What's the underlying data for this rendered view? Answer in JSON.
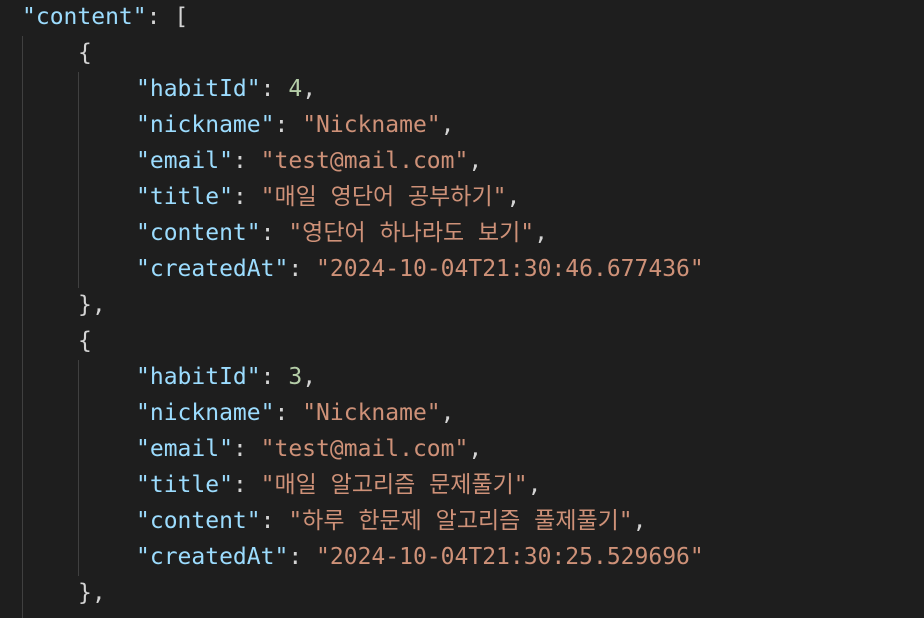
{
  "root_key": "\"content\"",
  "open_bracket": "[",
  "open_brace": "{",
  "close_brace": "},",
  "colon": ": ",
  "comma": ",",
  "items": [
    {
      "habitId_key": "\"habitId\"",
      "habitId_val": "4",
      "nickname_key": "\"nickname\"",
      "nickname_val": "\"Nickname\"",
      "email_key": "\"email\"",
      "email_val": "\"test@mail.com\"",
      "title_key": "\"title\"",
      "title_val": "\"매일 영단어 공부하기\"",
      "content_key": "\"content\"",
      "content_val": "\"영단어 하나라도 보기\"",
      "createdAt_key": "\"createdAt\"",
      "createdAt_val": "\"2024-10-04T21:30:46.677436\""
    },
    {
      "habitId_key": "\"habitId\"",
      "habitId_val": "3",
      "nickname_key": "\"nickname\"",
      "nickname_val": "\"Nickname\"",
      "email_key": "\"email\"",
      "email_val": "\"test@mail.com\"",
      "title_key": "\"title\"",
      "title_val": "\"매일 알고리즘 문제풀기\"",
      "content_key": "\"content\"",
      "content_val": "\"하루 한문제 알고리즘 풀제풀기\"",
      "createdAt_key": "\"createdAt\"",
      "createdAt_val": "\"2024-10-04T21:30:25.529696\""
    }
  ]
}
